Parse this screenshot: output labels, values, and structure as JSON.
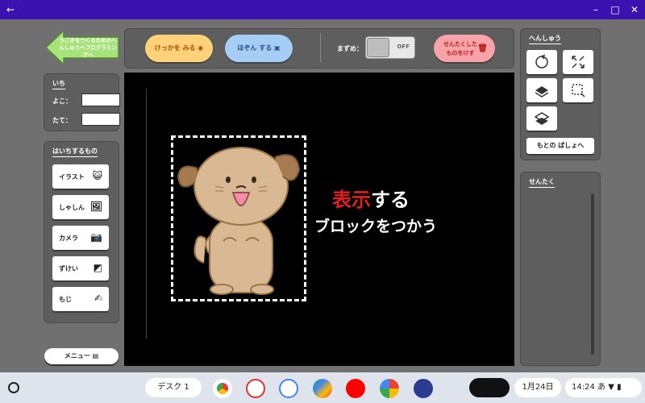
{
  "titlebar": {
    "back": "←",
    "minimize": "–",
    "restore": "□",
    "close": "✕"
  },
  "back_button": {
    "label": "うごきをつくるためのへんしゅうへプログラミングへ"
  },
  "position_panel": {
    "title": "いち",
    "x_label": "よこ：",
    "y_label": "たて：",
    "x_value": "",
    "y_value": ""
  },
  "place_panel": {
    "title": "はいちするもの",
    "items": [
      {
        "label": "イラスト",
        "icon": "cat-face-icon",
        "glyph": "😺"
      },
      {
        "label": "しゃしん",
        "icon": "image-icon",
        "glyph": "🖼"
      },
      {
        "label": "カメラ",
        "icon": "camera-icon",
        "glyph": "📷"
      },
      {
        "label": "ずけい",
        "icon": "shapes-icon",
        "glyph": "◩"
      },
      {
        "label": "もじ",
        "icon": "text-icon",
        "glyph": "✍"
      }
    ]
  },
  "menu_button": {
    "label": "メニュー ▤"
  },
  "toolbar": {
    "view_result": "けっかを みる",
    "save": "ほぞん する",
    "summary_label": "まずめ：",
    "toggle_state": "OFF",
    "delete_selected": "せんたくした ものをけす"
  },
  "stage": {
    "text_red": "表示",
    "text_white": "する",
    "text_line2": "ブロックをつかう"
  },
  "edit_panel": {
    "title": "へんしゅう",
    "reset_button": "もとの ばしょへ"
  },
  "select_panel": {
    "title": "せんたく"
  },
  "shelf": {
    "desk": "デスク 1",
    "date": "1月24日",
    "time": "14:24",
    "ime": "あ"
  },
  "colors": {
    "titlebar": "#3a12b0",
    "stage": "#000000",
    "accent_red": "#e41e1e",
    "view_btn": "#ffd27a",
    "save_btn": "#a6cef5",
    "delete_btn": "#f7a3a8"
  }
}
